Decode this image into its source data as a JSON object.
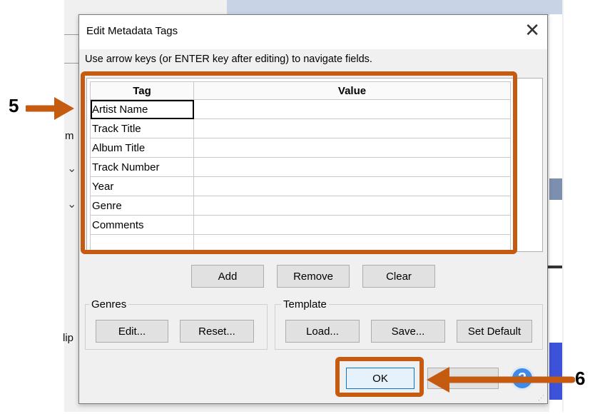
{
  "dialog": {
    "title": "Edit Metadata Tags",
    "instructions": "Use arrow keys (or ENTER key after editing) to navigate fields."
  },
  "grid": {
    "columns": [
      "Tag",
      "Value"
    ],
    "rows": [
      {
        "tag": "Artist Name",
        "value": ""
      },
      {
        "tag": "Track Title",
        "value": ""
      },
      {
        "tag": "Album Title",
        "value": ""
      },
      {
        "tag": "Track Number",
        "value": ""
      },
      {
        "tag": "Year",
        "value": ""
      },
      {
        "tag": "Genre",
        "value": ""
      },
      {
        "tag": "Comments",
        "value": ""
      },
      {
        "tag": "",
        "value": ""
      }
    ]
  },
  "row_buttons": {
    "add": "Add",
    "remove": "Remove",
    "clear": "Clear"
  },
  "genres": {
    "label": "Genres",
    "edit": "Edit...",
    "reset": "Reset..."
  },
  "template": {
    "label": "Template",
    "load": "Load...",
    "save": "Save...",
    "set_default": "Set Default"
  },
  "footer": {
    "ok": "OK",
    "help_glyph": "?"
  },
  "background": {
    "frag_m": "m",
    "frag_clip": "lip"
  },
  "annotations": {
    "marker_5": "5",
    "marker_6": "6",
    "highlight_color": "#c55a11",
    "arrow_color": "#c55a11"
  }
}
